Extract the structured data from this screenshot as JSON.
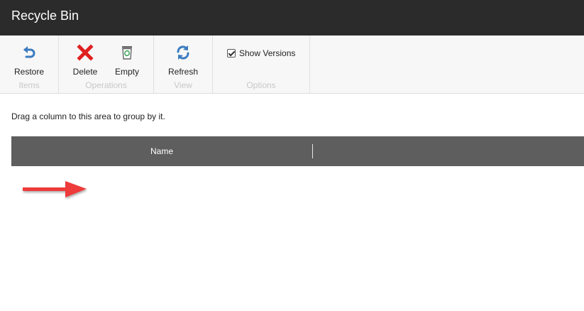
{
  "window": {
    "title": "Recycle Bin"
  },
  "ribbon": {
    "groups": {
      "items": {
        "label": "Items",
        "restore_label": "Restore"
      },
      "operations": {
        "label": "Operations",
        "delete_label": "Delete",
        "empty_label": "Empty"
      },
      "view": {
        "label": "View",
        "refresh_label": "Refresh"
      },
      "options": {
        "label": "Options",
        "show_versions_label": "Show Versions",
        "show_versions_checked": true
      }
    }
  },
  "grid": {
    "group_hint": "Drag a column to this area to group by it.",
    "columns": [
      "Name"
    ]
  },
  "icons": {
    "restore": "undo-arrow-icon",
    "delete": "red-x-icon",
    "empty": "trash-bin-icon",
    "refresh": "refresh-icon",
    "annotation": "red-arrow-icon"
  },
  "colors": {
    "titlebar": "#2b2b2b",
    "ribbon": "#f7f7f7",
    "grid_header": "#5e5e5e",
    "accent_blue": "#3b7bbf",
    "delete_red": "#e02020",
    "annotation_red": "#ee3b3b"
  }
}
